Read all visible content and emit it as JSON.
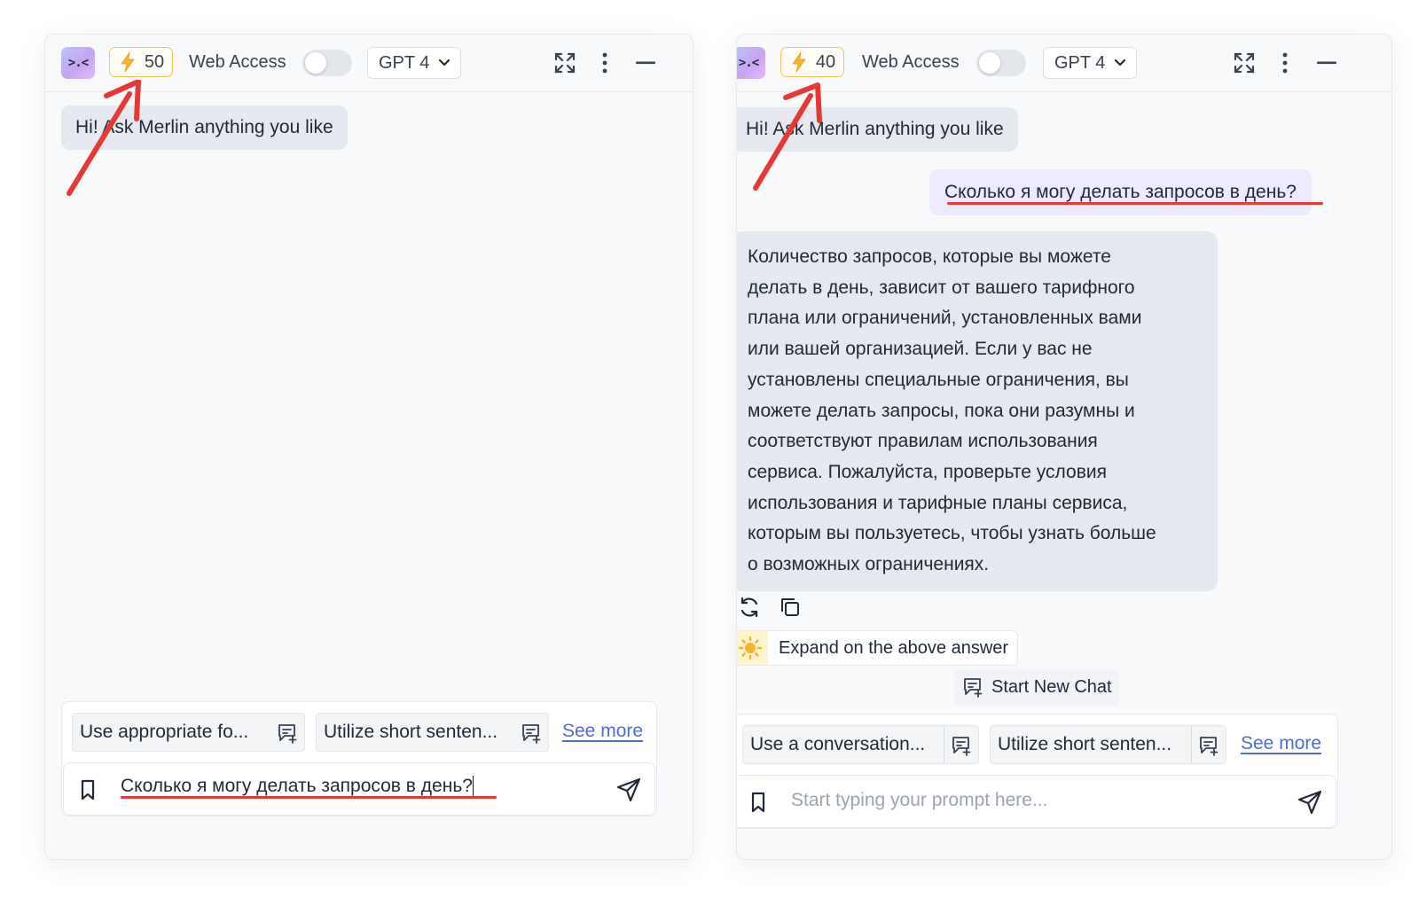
{
  "colors": {
    "accent": "#4f6bd8",
    "annotation": "#e53935",
    "credits_border": "#f5c25a",
    "bot_bubble": "#e5e8ef",
    "user_bubble": "#ede9fe"
  },
  "left": {
    "header": {
      "logo": ">.<",
      "credits": "50",
      "web_access_label": "Web Access",
      "web_access_enabled": false,
      "model": "GPT 4"
    },
    "greeting": "Hi! Ask Merlin anything you like",
    "suggestions": [
      {
        "label": "Use appropriate fo...",
        "icon": "message-plus-icon"
      },
      {
        "label": "Utilize short senten...",
        "icon": "message-plus-icon"
      }
    ],
    "see_more": "See more",
    "input_value": "Сколько я могу делать запросов в день?"
  },
  "right": {
    "header": {
      "logo": ">.<",
      "credits": "40",
      "web_access_label": "Web Access",
      "web_access_enabled": false,
      "model": "GPT 4"
    },
    "greeting": "Hi! Ask Merlin anything you like",
    "user_message": "Сколько я могу делать запросов в день?",
    "response_lines": [
      "Количество запросов, которые вы можете",
      "делать в день, зависит от вашего тарифного",
      "плана или ограничений, установленных вами",
      "или вашей организацией. Если у вас не",
      "установлены специальные ограничения, вы",
      "можете делать запросы, пока они разумны и",
      "соответствуют правилам использования",
      "сервиса. Пожалуйста, проверьте условия",
      "использования и тарифные планы сервиса,",
      "которым вы пользуетесь, чтобы узнать больше",
      "о возможных ограничениях."
    ],
    "expand_label": "Expand on the above answer",
    "new_chat_label": "Start New Chat",
    "suggestions": [
      {
        "label": "Use a conversation...",
        "icon": "message-plus-icon"
      },
      {
        "label": "Utilize short senten...",
        "icon": "message-plus-icon"
      }
    ],
    "see_more": "See more",
    "input_placeholder": "Start typing your prompt here..."
  }
}
